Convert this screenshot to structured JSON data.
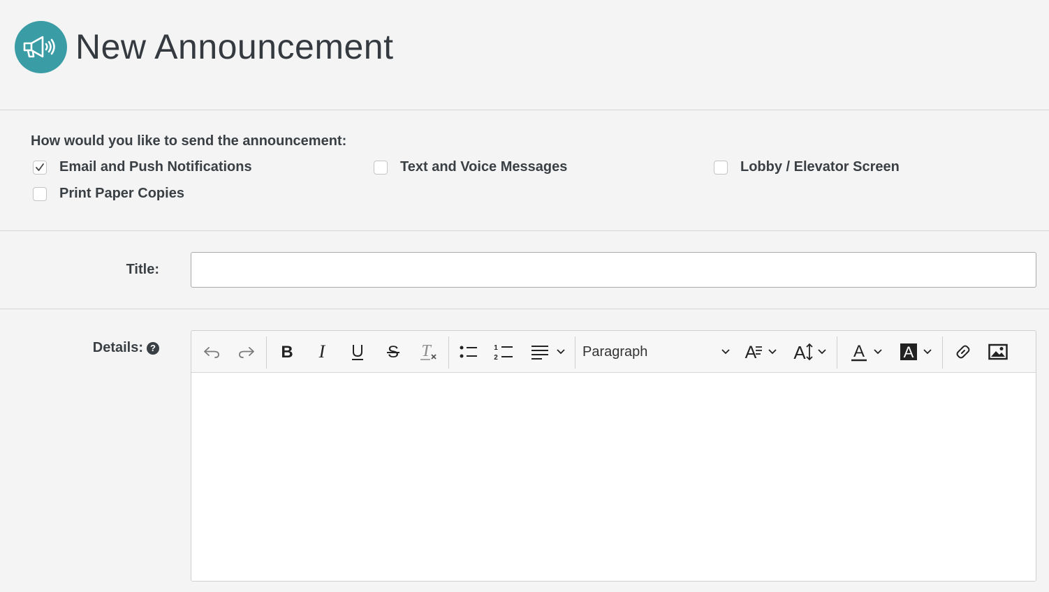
{
  "header": {
    "title": "New Announcement",
    "logo_icon": "megaphone-icon",
    "logo_color": "#3a9da5"
  },
  "send_options": {
    "label": "How would you like to send the announcement:",
    "options": [
      {
        "label": "Email and Push Notifications",
        "checked": true
      },
      {
        "label": "Text and Voice Messages",
        "checked": false
      },
      {
        "label": "Lobby / Elevator Screen",
        "checked": false
      },
      {
        "label": "Print Paper Copies",
        "checked": false
      }
    ]
  },
  "title_field": {
    "label": "Title:",
    "value": "",
    "placeholder": ""
  },
  "details_field": {
    "label": "Details:",
    "help_icon": "question-circle-icon",
    "toolbar": {
      "buttons": [
        "undo-icon",
        "redo-icon",
        "bold-icon",
        "italic-icon",
        "underline-icon",
        "strikethrough-icon",
        "clear-formatting-icon",
        "bullet-list-icon",
        "numbered-list-icon",
        "align-icon",
        "font-family-icon",
        "font-size-icon",
        "text-color-icon",
        "background-color-icon",
        "link-icon",
        "image-icon"
      ],
      "block_format": "Paragraph"
    },
    "body": ""
  }
}
